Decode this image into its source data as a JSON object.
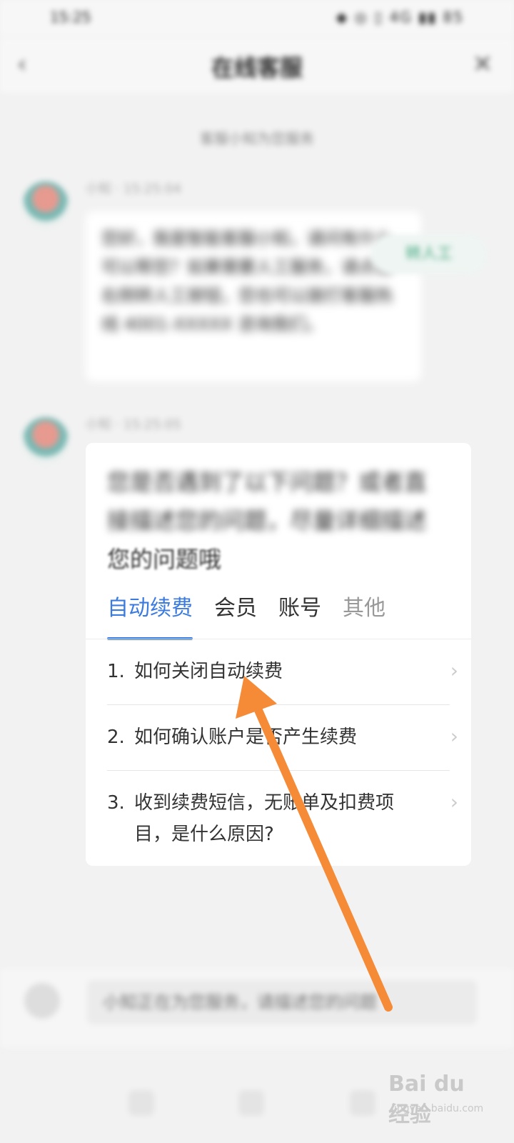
{
  "status": {
    "time": "15:25",
    "icons": "◆ ◎ ▯ 4G ▮▮ 85"
  },
  "header": {
    "title": "在线客服",
    "back": "‹",
    "close": "✕"
  },
  "system_note": "客服小知为您服务",
  "messages": [
    {
      "sender": "小知 · 15:25:04",
      "text": "您好，我是智能客服小知，请问有什么可以帮您？如果需要人工服务，请点击右侧转人工按钮，您也可以拨打客服热线 4001-XXXXX 咨询我们。",
      "action_label": "转人工"
    },
    {
      "sender": "小知 · 15:25:05",
      "title_blurred": "您是否遇到了以下问题？或者直接描述您的问题，尽量详细描述",
      "title_visible": "您的问题哦",
      "tabs": [
        {
          "label": "自动续费",
          "active": true
        },
        {
          "label": "会员",
          "active": false
        },
        {
          "label": "账号",
          "active": false
        },
        {
          "label": "其他",
          "active": false
        }
      ],
      "questions": [
        {
          "num": "1.",
          "text": "如何关闭自动续费"
        },
        {
          "num": "2.",
          "text": "如何确认账户是否产生续费"
        },
        {
          "num": "3.",
          "text": "收到续费短信，无账单及扣费项目，是什么原因?"
        }
      ]
    }
  ],
  "input": {
    "placeholder": "小知正在为您服务，请描述您的问题"
  },
  "watermark": {
    "text": "Bai du 经验",
    "sub": "jingyan.baidu.com"
  },
  "colors": {
    "accent": "#3b7be0",
    "arrow": "#f58a37"
  }
}
